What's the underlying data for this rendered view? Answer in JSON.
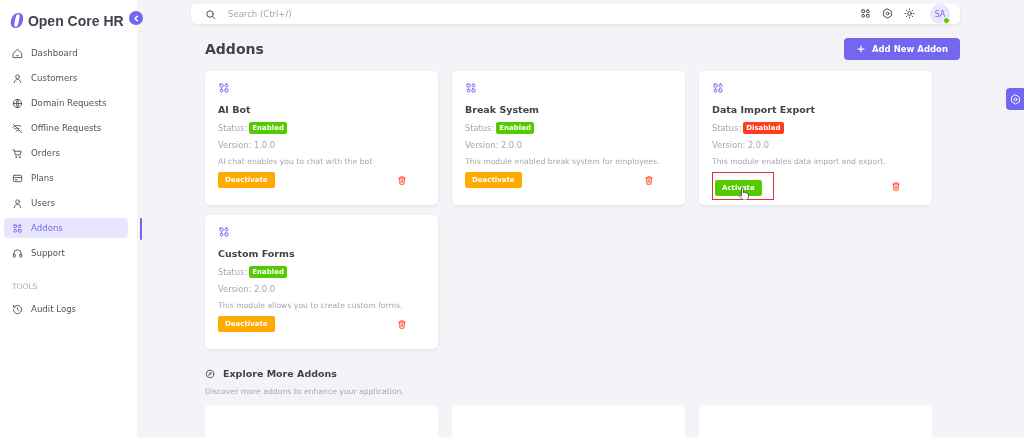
{
  "brand": {
    "logo": "0",
    "name": "Open Core HR"
  },
  "sidebar": {
    "items": [
      {
        "label": "Dashboard",
        "selected": false
      },
      {
        "label": "Customers",
        "selected": false
      },
      {
        "label": "Domain Requests",
        "selected": false
      },
      {
        "label": "Offline Requests",
        "selected": false
      },
      {
        "label": "Orders",
        "selected": false
      },
      {
        "label": "Plans",
        "selected": false
      },
      {
        "label": "Users",
        "selected": false
      },
      {
        "label": "Addons",
        "selected": true
      },
      {
        "label": "Support",
        "selected": false
      }
    ],
    "sections": [
      {
        "title": "TOOLS",
        "items": [
          {
            "label": "Audit Logs",
            "selected": false
          }
        ]
      }
    ]
  },
  "header": {
    "search": {
      "placeholder": "Search (Ctrl+/)"
    },
    "avatar": {
      "initials": "SA",
      "online": true
    }
  },
  "page": {
    "title": "Addons",
    "add_button": "Add New Addon"
  },
  "addons": [
    {
      "name": "AI Bot",
      "status_label": "Status:",
      "status": "Enabled",
      "enabled": true,
      "version": "Version: 1.0.0",
      "description": "AI chat enables you to chat with the bot",
      "action": "Deactivate",
      "highlighted": false
    },
    {
      "name": "Break System",
      "status_label": "Status:",
      "status": "Enabled",
      "enabled": true,
      "version": "Version: 2.0.0",
      "description": "This module enabled break system for employees.",
      "action": "Deactivate",
      "highlighted": false
    },
    {
      "name": "Data Import Export",
      "status_label": "Status:",
      "status": "Disabled",
      "enabled": false,
      "version": "Version: 2.0.0",
      "description": "This module enables data import and export.",
      "action": "Activate",
      "highlighted": true
    },
    {
      "name": "Custom Forms",
      "status_label": "Status:",
      "status": "Enabled",
      "enabled": true,
      "version": "Version: 2.0.0",
      "description": "This module allows you to create custom forms.",
      "action": "Deactivate",
      "highlighted": false
    }
  ],
  "explore": {
    "title": "Explore More Addons",
    "description": "Discover more addons to enhance your application."
  }
}
